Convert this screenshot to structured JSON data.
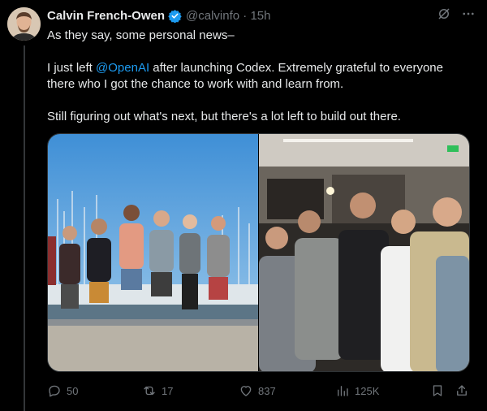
{
  "post": {
    "author_name": "Calvin French-Owen",
    "handle_time": "@calvinfo · 15h",
    "line1": "As they say, some personal news–",
    "line2_pre": "I just left ",
    "line2_mention": "@OpenAI",
    "line2_post": " after launching Codex. Extremely grateful to everyone",
    "line3": "there who I got the chance to work with and learn from.",
    "line4": "Still figuring out what's next, but there's a lot left to build out there."
  },
  "metrics": {
    "replies": "50",
    "reposts": "17",
    "likes": "837",
    "views": "125K"
  },
  "icons": {
    "verified": "verified-badge-icon",
    "grok": "grok-icon",
    "more": "more-icon",
    "reply": "reply-icon",
    "repost": "repost-icon",
    "like": "heart-icon",
    "views": "views-icon",
    "bookmark": "bookmark-icon",
    "share": "share-icon"
  },
  "colors": {
    "background": "#000000",
    "text": "#e7e9ea",
    "muted": "#71767b",
    "accent": "#1d9bf0"
  }
}
